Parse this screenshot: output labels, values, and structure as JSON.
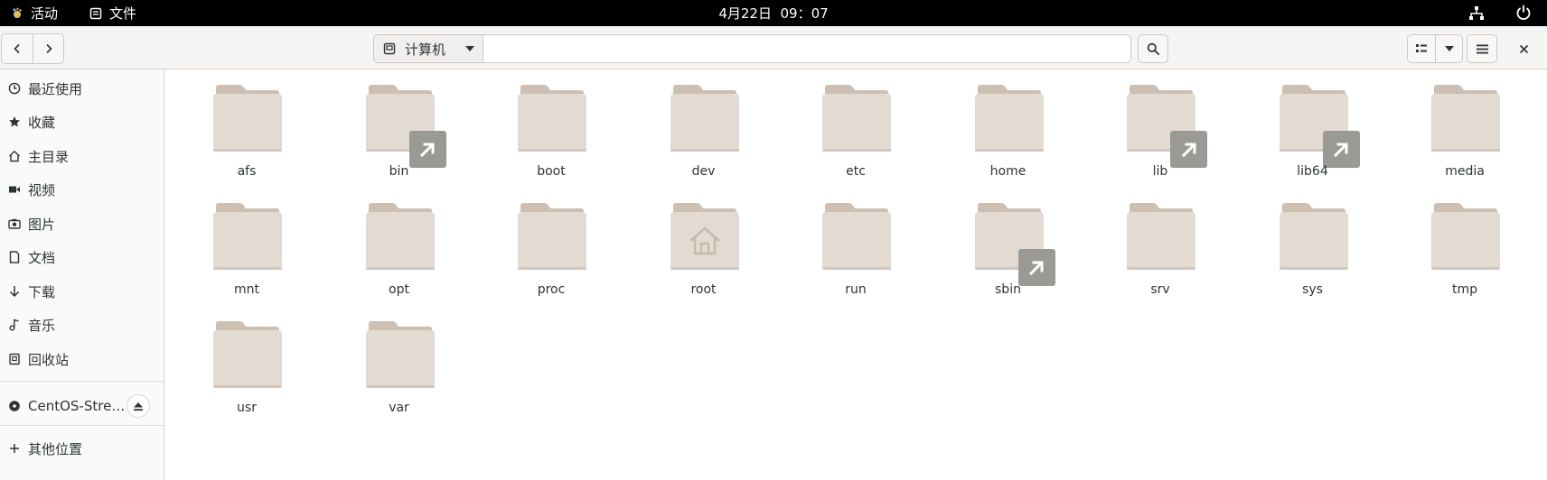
{
  "topbar": {
    "activities": "活动",
    "app_name": "文件",
    "clock": "4月22日  09：07"
  },
  "header": {
    "location": "计算机",
    "path_value": ""
  },
  "sidebar": {
    "items": [
      {
        "label": "最近使用",
        "icon": "clock-icon"
      },
      {
        "label": "收藏",
        "icon": "star-icon"
      },
      {
        "label": "主目录",
        "icon": "home-icon"
      },
      {
        "label": "视频",
        "icon": "video-icon"
      },
      {
        "label": "图片",
        "icon": "camera-icon"
      },
      {
        "label": "文档",
        "icon": "document-icon"
      },
      {
        "label": "下载",
        "icon": "download-icon"
      },
      {
        "label": "音乐",
        "icon": "music-icon"
      },
      {
        "label": "回收站",
        "icon": "trash-icon"
      }
    ],
    "device": {
      "label": "CentOS-Stre…",
      "icon": "disc-icon"
    },
    "other": {
      "label": "其他位置",
      "icon": "plus-icon"
    }
  },
  "files": [
    {
      "name": "afs",
      "type": "folder"
    },
    {
      "name": "bin",
      "type": "symlink"
    },
    {
      "name": "boot",
      "type": "folder"
    },
    {
      "name": "dev",
      "type": "folder"
    },
    {
      "name": "etc",
      "type": "folder"
    },
    {
      "name": "home",
      "type": "folder"
    },
    {
      "name": "lib",
      "type": "symlink"
    },
    {
      "name": "lib64",
      "type": "symlink"
    },
    {
      "name": "media",
      "type": "folder"
    },
    {
      "name": "mnt",
      "type": "folder"
    },
    {
      "name": "opt",
      "type": "folder"
    },
    {
      "name": "proc",
      "type": "folder"
    },
    {
      "name": "root",
      "type": "home"
    },
    {
      "name": "run",
      "type": "folder"
    },
    {
      "name": "sbin",
      "type": "symlink"
    },
    {
      "name": "srv",
      "type": "folder"
    },
    {
      "name": "sys",
      "type": "folder"
    },
    {
      "name": "tmp",
      "type": "folder"
    },
    {
      "name": "usr",
      "type": "folder"
    },
    {
      "name": "var",
      "type": "folder"
    }
  ],
  "colors": {
    "folder_body": "#e3dad1",
    "folder_back": "#cdbfb2",
    "link_badge": "#9a9996"
  }
}
